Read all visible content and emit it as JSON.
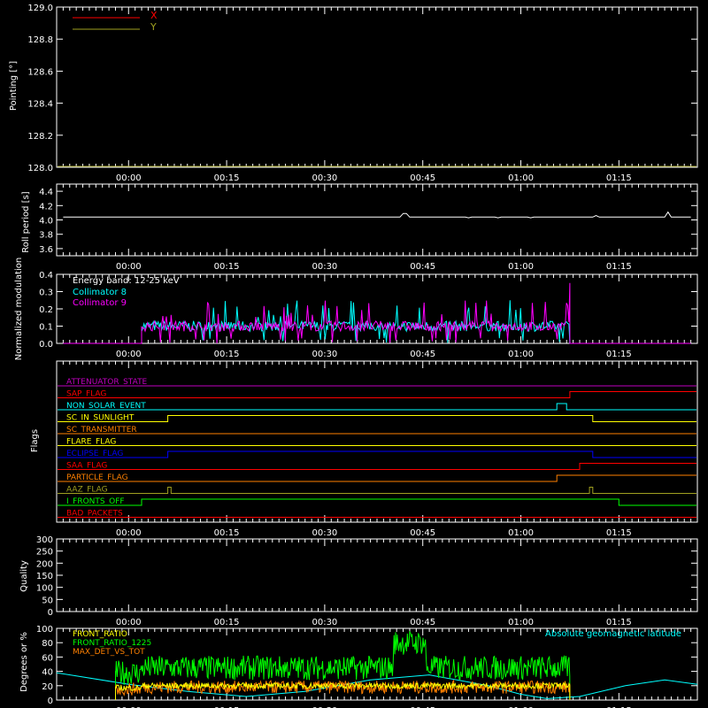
{
  "colors": {
    "background": "#000000",
    "axis": "#ffffff",
    "red": "#ff0000",
    "olive": "#a0a020",
    "cyan": "#00ffff",
    "magenta": "#ff00ff",
    "green": "#00ff00",
    "orange": "#ff8000",
    "yellow": "#ffff00",
    "blue": "#0000ff",
    "purple": "#c000c0"
  },
  "time_ticks": [
    "00:00",
    "00:15",
    "00:30",
    "00:45",
    "01:00",
    "01:15"
  ],
  "chart_data": [
    {
      "type": "line",
      "ylabel": "Pointing [°]",
      "ylim": [
        128.0,
        129.0
      ],
      "yticks": [
        "128.0",
        "128.2",
        "128.4",
        "128.6",
        "128.8",
        "129.0"
      ],
      "xlim_minutes": [
        -11,
        87
      ],
      "legend": [
        {
          "name": "X",
          "color": "#ff0000"
        },
        {
          "name": "Y",
          "color": "#a0a020"
        }
      ],
      "series": []
    },
    {
      "type": "line",
      "ylabel": "Roll period [s]",
      "ylim": [
        3.5,
        4.5
      ],
      "yticks": [
        "3.6",
        "3.8",
        "4.0",
        "4.2",
        "4.4"
      ],
      "baseline_value": 4.04,
      "spikes_minutes": [
        [
          42.2,
          4.09
        ],
        [
          52.0,
          4.03
        ],
        [
          56.5,
          4.03
        ],
        [
          61.5,
          4.03
        ],
        [
          71.5,
          4.06
        ],
        [
          82.5,
          4.11
        ]
      ]
    },
    {
      "type": "line",
      "ylabel": "Normalized modulation",
      "ylim": [
        0.0,
        0.4
      ],
      "yticks": [
        "0.0",
        "0.1",
        "0.2",
        "0.3",
        "0.4"
      ],
      "annotation": "Energy band: 12-25 keV",
      "legend": [
        {
          "name": "Collimator 8",
          "color": "#00ffff"
        },
        {
          "name": "Collimator 9",
          "color": "#ff00ff"
        }
      ],
      "active_range_minutes": [
        2.0,
        67.5
      ],
      "typical_value": 0.1
    },
    {
      "type": "line",
      "ylabel": "Flags",
      "flags": [
        {
          "name": "ATTENUATOR_STATE",
          "color": "#c000c0",
          "steps": []
        },
        {
          "name": "SAP_FLAG",
          "color": "#ff0000",
          "steps": [
            67.5
          ]
        },
        {
          "name": "NON_SOLAR_EVENT",
          "color": "#00ffff",
          "steps": [
            65.5,
            67.0
          ]
        },
        {
          "name": "SC_IN_SUNLIGHT",
          "color": "#ffff00",
          "steps": [
            6.0,
            71.0
          ]
        },
        {
          "name": "SC_TRANSMITTER",
          "color": "#ff8000",
          "steps": []
        },
        {
          "name": "FLARE_FLAG",
          "color": "#ffff00",
          "steps": []
        },
        {
          "name": "ECLIPSE_FLAG",
          "color": "#0000ff",
          "steps": [
            6.0,
            71.0
          ]
        },
        {
          "name": "SAA_FLAG",
          "color": "#ff0000",
          "steps": [
            69.0
          ]
        },
        {
          "name": "PARTICLE_FLAG",
          "color": "#ff8000",
          "steps": [
            65.5
          ]
        },
        {
          "name": "AAZ_FLAG",
          "color": "#a0a020",
          "steps": [
            6.0,
            6.5,
            70.5,
            71.0
          ]
        },
        {
          "name": "I_FRONTS_OFF",
          "color": "#00ff00",
          "steps": [
            2.0,
            75.0
          ]
        },
        {
          "name": "BAD_PACKETS",
          "color": "#ff0000",
          "steps": []
        }
      ]
    },
    {
      "type": "line",
      "ylabel": "Quality",
      "ylim": [
        0,
        300
      ],
      "yticks": [
        "0",
        "50",
        "100",
        "150",
        "200",
        "250",
        "300"
      ],
      "baseline_value": 300
    },
    {
      "type": "line",
      "ylabel": "Degrees or %",
      "ylim": [
        0,
        100
      ],
      "yticks": [
        "0",
        "20",
        "40",
        "60",
        "80",
        "100"
      ],
      "legend": [
        {
          "name": "FRONT_RATIO",
          "color": "#ffff00"
        },
        {
          "name": "FRONT_RATIO_1225",
          "color": "#00ff00"
        },
        {
          "name": "MAX_DET_VS_TOT",
          "color": "#ff8000"
        }
      ],
      "annotation": "Absolute geomagnetic latitude",
      "annotation_color": "#00ffff",
      "active_range_minutes": [
        2.0,
        67.5
      ],
      "front_ratio_1225_typical": 45,
      "front_ratio_1225_elevated": [
        [
          40.5,
          45.5,
          80
        ]
      ],
      "max_det_typical": 18,
      "front_ratio_typical": 20,
      "geomag_latitude_points": [
        [
          -11,
          38
        ],
        [
          0,
          22
        ],
        [
          9,
          12
        ],
        [
          18,
          5
        ],
        [
          27,
          12
        ],
        [
          37,
          28
        ],
        [
          46,
          35
        ],
        [
          55,
          20
        ],
        [
          60,
          8
        ],
        [
          64,
          2
        ],
        [
          69,
          5
        ],
        [
          76,
          20
        ],
        [
          82,
          28
        ],
        [
          87,
          22
        ]
      ]
    }
  ]
}
